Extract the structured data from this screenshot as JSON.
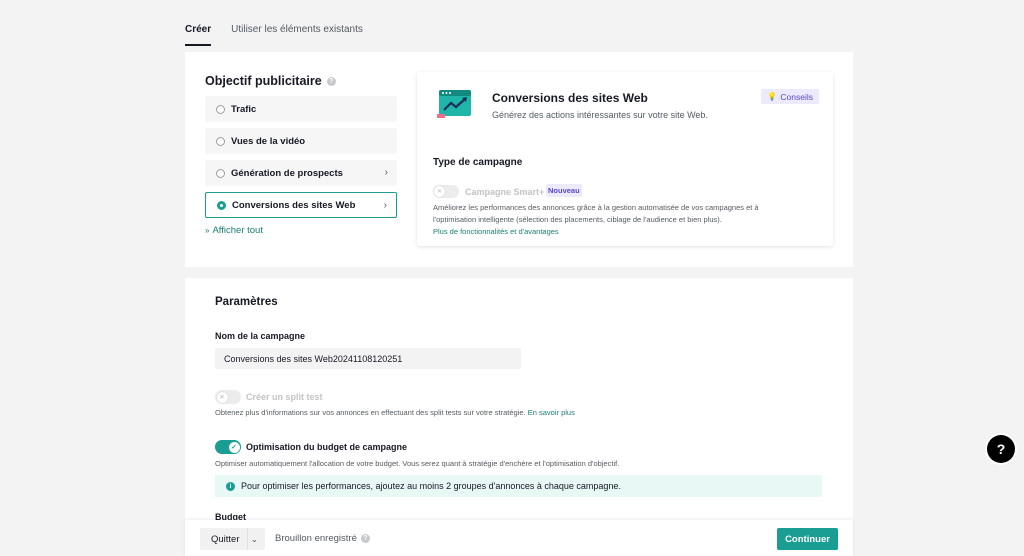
{
  "tabs": [
    {
      "label": "Créer",
      "active": true
    },
    {
      "label": "Utiliser les éléments existants",
      "active": false
    }
  ],
  "objective": {
    "title": "Objectif publicitaire",
    "options": [
      {
        "label": "Trafic",
        "selected": false
      },
      {
        "label": "Vues de la vidéo",
        "selected": false
      },
      {
        "label": "Génération de prospects",
        "selected": false
      },
      {
        "label": "Conversions des sites Web",
        "selected": true
      }
    ],
    "show_all": "Afficher tout"
  },
  "conversion_card": {
    "title": "Conversions des sites Web",
    "subtitle": "Générez des actions intéressantes sur votre site Web.",
    "tips_label": "Conseils",
    "campaign_type_title": "Type de campagne",
    "smart_label": "Campagne Smart+",
    "new_badge": "Nouveau",
    "smart_description": "Améliorez les performances des annonces grâce à la gestion automatisée de vos campagnes et à l'optimisation intelligente (sélection des placements, ciblage de l'audience et bien plus).",
    "smart_link": "Plus de fonctionnalités et d'avantages"
  },
  "params": {
    "title": "Paramètres",
    "campaign_name_label": "Nom de la campagne",
    "campaign_name_value": "Conversions des sites Web20241108120251",
    "split_test_label": "Créer un split test",
    "split_test_desc": "Obtenez plus d'informations sur vos annonces en effectuant des split tests sur votre stratégie.",
    "split_test_link": "En savoir plus",
    "budget_opt_label": "Optimisation du budget de campagne",
    "budget_opt_desc": "Optimiser automatiquement l'allocation de votre budget. Vous serez quant à stratégie d'enchère et l'optimisation d'objectif.",
    "info_banner": "Pour optimiser les performances, ajoutez au moins 2 groupes d'annonces à chaque campagne.",
    "budget_label": "Budget"
  },
  "footer": {
    "quit_label": "Quitter",
    "draft_label": "Brouillon enregistré",
    "continue_label": "Continuer"
  },
  "help_fab": "?",
  "colors": {
    "accent": "#1a9d92",
    "purple": "#5a47c7",
    "background": "#f3f3f4"
  }
}
